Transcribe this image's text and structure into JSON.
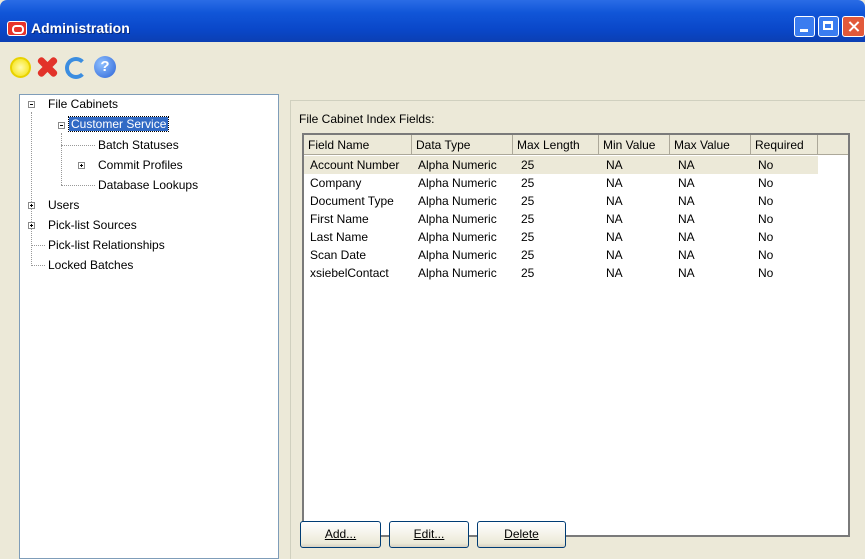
{
  "window": {
    "title": "Administration"
  },
  "toolbar": {
    "new_icon": "new-icon",
    "delete_icon": "delete-icon",
    "refresh_icon": "refresh-icon",
    "help_icon": "help-icon"
  },
  "tree": {
    "file_cabinets": "File Cabinets",
    "customer_service": "Customer Service",
    "batch_statuses": "Batch Statuses",
    "commit_profiles": "Commit Profiles",
    "database_lookups": "Database Lookups",
    "users": "Users",
    "picklist_sources": "Pick-list Sources",
    "picklist_relationships": "Pick-list Relationships",
    "locked_batches": "Locked Batches"
  },
  "panel": {
    "label": "File Cabinet Index Fields:"
  },
  "table": {
    "columns": [
      "Field Name",
      "Data Type",
      "Max Length",
      "Min Value",
      "Max Value",
      "Required"
    ],
    "rows": [
      [
        "Account Number",
        "Alpha Numeric",
        "25",
        "NA",
        "NA",
        "No"
      ],
      [
        "Company",
        "Alpha Numeric",
        "25",
        "NA",
        "NA",
        "No"
      ],
      [
        "Document Type",
        "Alpha Numeric",
        "25",
        "NA",
        "NA",
        "No"
      ],
      [
        "First Name",
        "Alpha Numeric",
        "25",
        "NA",
        "NA",
        "No"
      ],
      [
        "Last Name",
        "Alpha Numeric",
        "25",
        "NA",
        "NA",
        "No"
      ],
      [
        "Scan Date",
        "Alpha Numeric",
        "25",
        "NA",
        "NA",
        "No"
      ],
      [
        "xsiebelContact",
        "Alpha Numeric",
        "25",
        "NA",
        "NA",
        "No"
      ]
    ]
  },
  "buttons": {
    "add": "Add...",
    "edit": "Edit...",
    "delete": "Delete"
  }
}
